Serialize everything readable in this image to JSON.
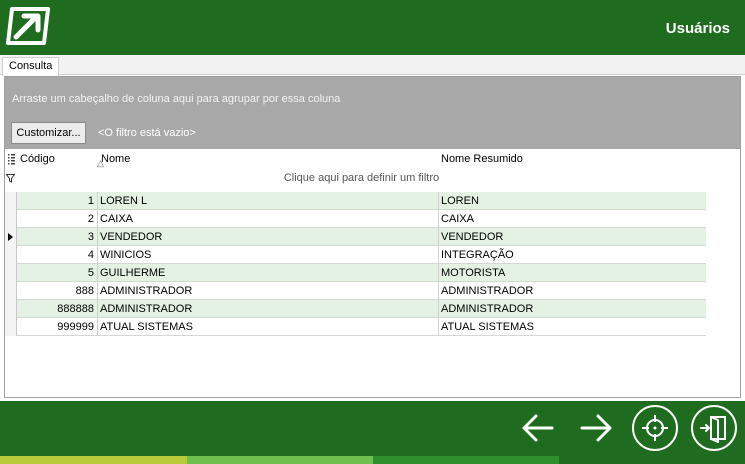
{
  "header": {
    "title": "Usuários",
    "logo_icon": "arrow-box-logo-icon",
    "background": "#1f6b1f"
  },
  "tabs": [
    {
      "label": "Consulta",
      "selected": true
    }
  ],
  "group_panel": {
    "hint": "Arraste um cabeçalho de coluna aqui para agrupar por essa coluna",
    "customize_label": "Customizar...",
    "filter_status": "<O filtro está vazio>"
  },
  "table": {
    "columns": [
      "Código",
      "Nome",
      "Nome Resumido"
    ],
    "sorted_column": "Código",
    "filter_placeholder": "Clique aqui para definir um filtro",
    "current_row": 2,
    "rows": [
      {
        "code": "1",
        "name": "LOREN L",
        "short": "LOREN"
      },
      {
        "code": "2",
        "name": "CAIXA",
        "short": "CAIXA"
      },
      {
        "code": "3",
        "name": "VENDEDOR",
        "short": "VENDEDOR"
      },
      {
        "code": "4",
        "name": "WINICIOS",
        "short": "INTEGRAÇÃO"
      },
      {
        "code": "5",
        "name": "GUILHERME",
        "short": "MOTORISTA"
      },
      {
        "code": "888",
        "name": "ADMINISTRADOR",
        "short": "ADMINISTRADOR"
      },
      {
        "code": "888888",
        "name": "ADMINISTRADOR",
        "short": "ADMINISTRADOR"
      },
      {
        "code": "999999",
        "name": "ATUAL SISTEMAS",
        "short": "ATUAL SISTEMAS"
      }
    ]
  },
  "footer": {
    "buttons": [
      "arrow-left-icon",
      "arrow-right-icon",
      "crosshair-icon",
      "exit-door-icon"
    ],
    "stripe_colors": [
      "#b8c93a",
      "#6fbf4f",
      "#2c8f2c",
      "#1f6b1f"
    ]
  }
}
